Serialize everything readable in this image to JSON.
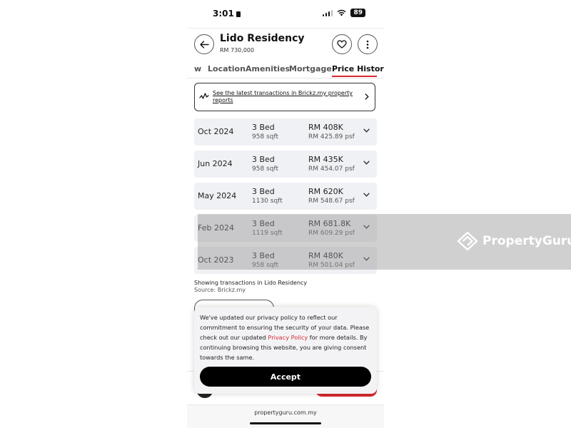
{
  "status_bar": {
    "time": "3:01",
    "battery": "89"
  },
  "header": {
    "title": "Lido Residency",
    "price": "RM 730,000"
  },
  "tabs": [
    {
      "label": "w"
    },
    {
      "label": "Location"
    },
    {
      "label": "Amenities"
    },
    {
      "label": "Mortgage"
    },
    {
      "label": "Price History"
    }
  ],
  "active_tab": "Price History",
  "banner": {
    "text": "See the latest transactions in Brickz.my property reports"
  },
  "transactions": [
    {
      "date": "Oct 2024",
      "bed": "3 Bed",
      "sqft": "958 sqft",
      "price": "RM 408K",
      "psf": "RM 425.89 psf"
    },
    {
      "date": "Jun 2024",
      "bed": "3 Bed",
      "sqft": "958 sqft",
      "price": "RM 435K",
      "psf": "RM 454.07 psf"
    },
    {
      "date": "May 2024",
      "bed": "3 Bed",
      "sqft": "1130 sqft",
      "price": "RM 620K",
      "psf": "RM 548.67 psf"
    },
    {
      "date": "Feb 2024",
      "bed": "3 Bed",
      "sqft": "1119 sqft",
      "price": "RM 681.8K",
      "psf": "RM 609.29 psf"
    },
    {
      "date": "Oct 2023",
      "bed": "3 Bed",
      "sqft": "958 sqft",
      "price": "RM 480K",
      "psf": "RM 501.04 psf"
    }
  ],
  "footer": {
    "showing": "Showing transactions in Lido Residency",
    "source": "Source: Brickz.my"
  },
  "consent": {
    "text_before": "We've updated our privacy policy to reflect our commitment to ensuring the security of your data. Please check out our updated ",
    "link": "Privacy Policy",
    "text_after": " for more details. By continuing browsing this website, you are giving consent towards the same.",
    "accept_label": "Accept"
  },
  "url": "propertyguru.com.my",
  "watermark": {
    "text": "PropertyGuru"
  },
  "colors": {
    "accent": "#d7292f",
    "row_bg": "#f0f1f4",
    "button": "#000000"
  }
}
